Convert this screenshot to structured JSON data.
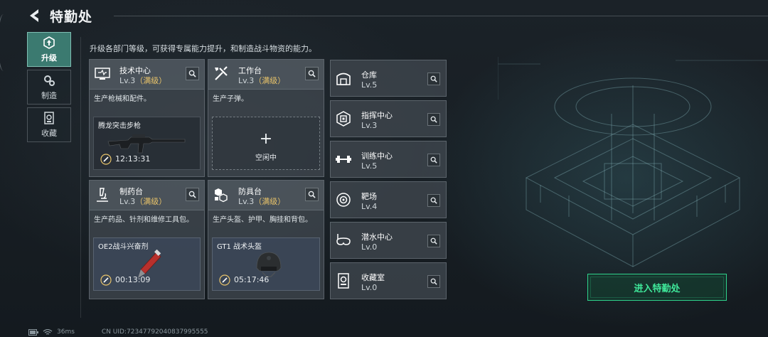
{
  "header": {
    "title": "特勤处"
  },
  "nav": [
    {
      "label": "升级",
      "icon": "upgrade-icon",
      "active": true
    },
    {
      "label": "制造",
      "icon": "gear-icon",
      "active": false
    },
    {
      "label": "收藏",
      "icon": "collection-icon",
      "active": false
    }
  ],
  "description": "升级各部门等级，可获得专属能力提升，和制造战斗物资的能力。",
  "departments": [
    {
      "name": "技术中心",
      "level": "Lv.3",
      "max": "（满级）",
      "desc": "生产枪械和配件。",
      "slot": {
        "item": "腾龙突击步枪",
        "timer": "12:13:31"
      }
    },
    {
      "name": "工作台",
      "level": "Lv.3",
      "max": "（满级）",
      "desc": "生产子弹。",
      "slot": {
        "empty": "空闲中"
      }
    },
    {
      "name": "制药台",
      "level": "Lv.3",
      "max": "（满级）",
      "desc": "生产药品、针剂和维修工具包。",
      "slot": {
        "item": "OE2战斗兴奋剂",
        "timer": "00:13:09"
      }
    },
    {
      "name": "防具台",
      "level": "Lv.3",
      "max": "（满级）",
      "desc": "生产头盔、护甲、胸挂和背包。",
      "slot": {
        "item": "GT1 战术头盔",
        "timer": "05:17:46"
      }
    }
  ],
  "facilities": [
    {
      "name": "仓库",
      "level": "Lv.5",
      "icon": "warehouse-icon"
    },
    {
      "name": "指挥中心",
      "level": "Lv.3",
      "icon": "chip-icon"
    },
    {
      "name": "训练中心",
      "level": "Lv.5",
      "icon": "dumbbell-icon"
    },
    {
      "name": "靶场",
      "level": "Lv.4",
      "icon": "target-icon"
    },
    {
      "name": "潜水中心",
      "level": "Lv.0",
      "icon": "diving-mask-icon"
    },
    {
      "name": "收藏室",
      "level": "Lv.0",
      "icon": "collection-room-icon"
    }
  ],
  "enter_button": "进入特勤处",
  "status": {
    "ping": "36ms",
    "uid": "CN UID:72347792040837995555"
  },
  "colors": {
    "accent_green": "#2fd38c",
    "max_level": "#e8c36a",
    "nav_active": "#3b7a70"
  }
}
